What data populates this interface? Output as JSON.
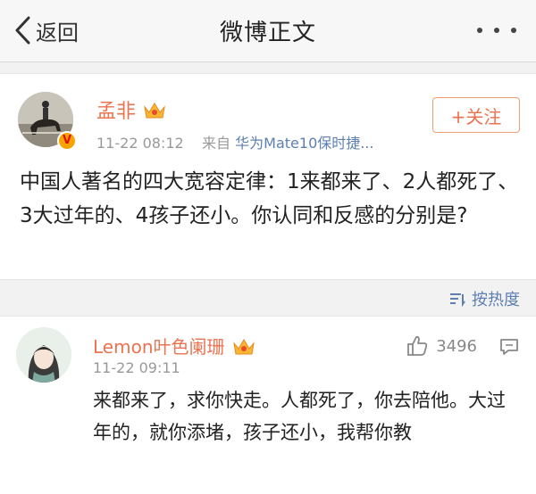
{
  "navbar": {
    "back_label": "返回",
    "title": "微博正文"
  },
  "post": {
    "username": "孟非",
    "time": "11-22 08:12",
    "source_prefix": "来自",
    "source": "华为Mate10保时捷...",
    "follow_label": "+关注",
    "badge": "V",
    "text": "中国人著名的四大宽容定律：1来都来了、2人都死了、3大过年的、4孩子还小。你认同和反感的分别是?"
  },
  "sort": {
    "label": "按热度"
  },
  "comment": {
    "username": "Lemon叶色阑珊",
    "time": "11-22 09:11",
    "likes": "3496",
    "text": "来都来了，求你快走。人都死了，你去陪他。大过年的，就你添堵，孩子还小，我帮你教"
  },
  "colors": {
    "accent": "#eb7350",
    "link": "#5d7fb1",
    "muted": "#999999",
    "badge": "#f8a400"
  }
}
